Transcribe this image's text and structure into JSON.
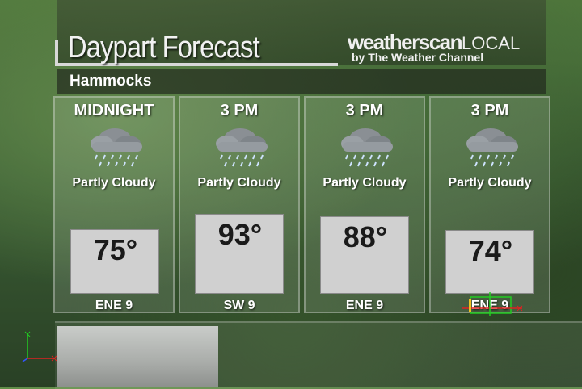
{
  "header": {
    "title": "Daypart Forecast",
    "brand_main": "weatherscan",
    "brand_local": "LOCAL",
    "brand_sub": "by The Weather Channel"
  },
  "location": {
    "name": "Hammocks"
  },
  "forecast": [
    {
      "time": "MIDNIGHT",
      "icon": "rain-cloud-icon",
      "condition": "Partly Cloudy",
      "temp": "75°",
      "wind": "ENE 9"
    },
    {
      "time": "3 PM",
      "icon": "rain-cloud-icon",
      "condition": "Partly Cloudy",
      "temp": "93°",
      "wind": "SW 9"
    },
    {
      "time": "3 PM",
      "icon": "rain-cloud-icon",
      "condition": "Partly Cloudy",
      "temp": "88°",
      "wind": "ENE 9"
    },
    {
      "time": "3 PM",
      "icon": "rain-cloud-icon",
      "condition": "Partly Cloudy",
      "temp": "74°",
      "wind": "ENE 9"
    }
  ],
  "temperatures_f": [
    75,
    93,
    88,
    74
  ],
  "colors": {
    "text": "#ffffff",
    "temp_box": "#d0d0d0",
    "temp_text": "#1a1a1a"
  }
}
